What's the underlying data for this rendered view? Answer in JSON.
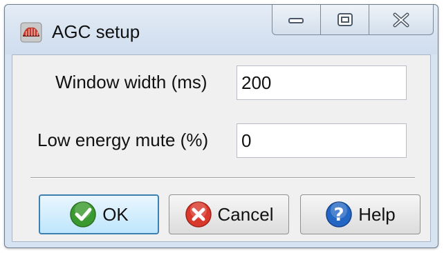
{
  "window": {
    "title": "AGC setup",
    "app_icon": "seismic-app-icon",
    "caption_buttons": {
      "minimize_icon": "minimize-icon",
      "maximize_icon": "maximize-icon",
      "close_icon": "close-icon"
    }
  },
  "form": {
    "window_width": {
      "label": "Window width (ms)",
      "value": "200"
    },
    "low_energy_mute": {
      "label": "Low energy mute (%)",
      "value": "0"
    }
  },
  "buttons": {
    "ok": {
      "label": "OK",
      "icon": "check-icon",
      "icon_color": "#3a9a2f"
    },
    "cancel": {
      "label": "Cancel",
      "icon": "cancel-x-icon",
      "icon_color": "#d9382c"
    },
    "help": {
      "label": "Help",
      "icon": "question-icon",
      "icon_color": "#2466c4"
    }
  },
  "colors": {
    "frame": "#d6e3f1",
    "default_button_border": "#3c7fb1"
  }
}
